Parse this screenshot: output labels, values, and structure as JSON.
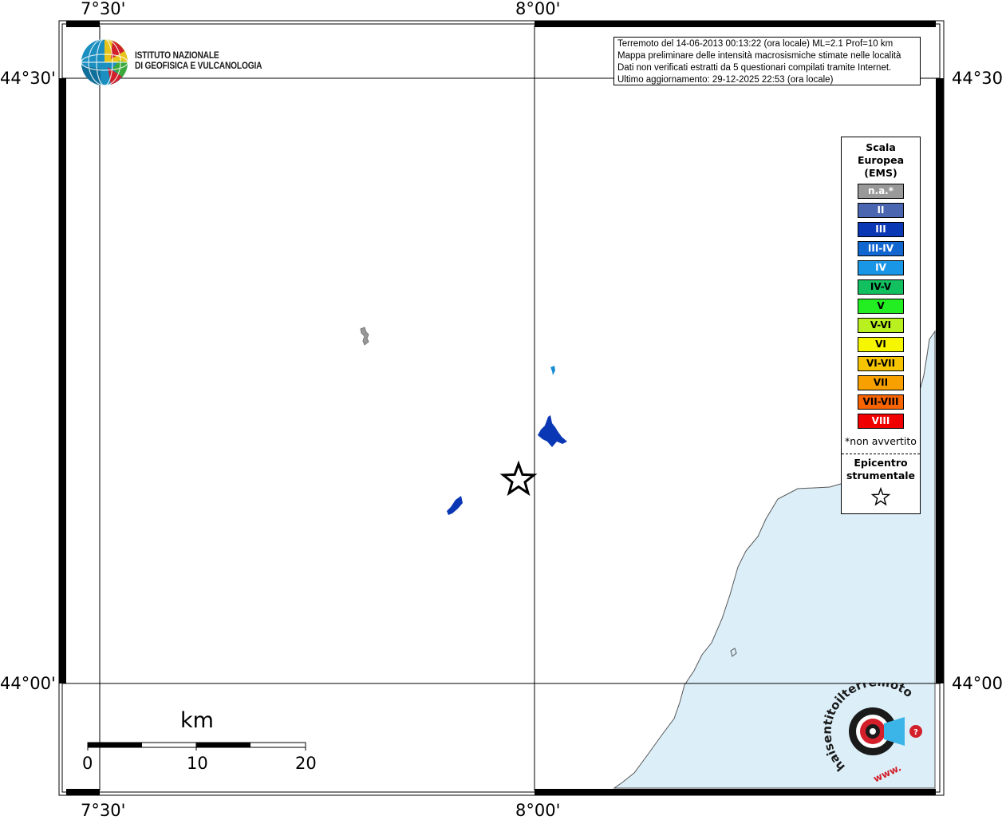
{
  "map": {
    "lon_labels": [
      "7°30'",
      "8°00'"
    ],
    "lat_labels": [
      "44°30'",
      "44°00'"
    ],
    "colors": {
      "sea": "#dceff9",
      "frame": "#000000",
      "grid": "#000000"
    },
    "localities": [
      {
        "intensity": "n.a.",
        "color": "#999999"
      },
      {
        "intensity": "IV",
        "color": "#1a8cd6"
      },
      {
        "intensity": "III",
        "color": "#0a37b4"
      },
      {
        "intensity": "III",
        "color": "#0a37b4"
      }
    ]
  },
  "info": {
    "line1": "Terremoto del 14-06-2013 00:13:22 (ora locale) ML=2.1 Prof=10 km",
    "line2": "Mappa preliminare delle intensità macrosismiche stimate nelle località",
    "line3": "Dati non verificati estratti da 5 questionari compilati tramite Internet.",
    "line4": "Ultimo aggiornamento: 29-12-2025 22:53 (ora locale)"
  },
  "logo": {
    "line1": "ISTITUTO NAZIONALE",
    "line2": "DI GEOFISICA E VULCANOLOGIA",
    "icon": "ingv-globe-logo"
  },
  "legend": {
    "title_lines": [
      "Scala",
      "Europea",
      "(EMS)"
    ],
    "items": [
      {
        "label": "n.a.*",
        "color": "#999999",
        "text_color": "#ffffff"
      },
      {
        "label": "II",
        "color": "#4a66b0",
        "text_color": "#ffffff"
      },
      {
        "label": "III",
        "color": "#0a37b4",
        "text_color": "#ffffff"
      },
      {
        "label": "III-IV",
        "color": "#1166d0",
        "text_color": "#ffffff"
      },
      {
        "label": "IV",
        "color": "#1a96e6",
        "text_color": "#ffffff"
      },
      {
        "label": "IV-V",
        "color": "#12c060",
        "text_color": "#000000"
      },
      {
        "label": "V",
        "color": "#22ee22",
        "text_color": "#000000"
      },
      {
        "label": "V-VI",
        "color": "#b8f020",
        "text_color": "#000000"
      },
      {
        "label": "VI",
        "color": "#f6f600",
        "text_color": "#000000"
      },
      {
        "label": "VI-VII",
        "color": "#f6c400",
        "text_color": "#000000"
      },
      {
        "label": "VII",
        "color": "#f8a000",
        "text_color": "#000000"
      },
      {
        "label": "VII-VIII",
        "color": "#f86400",
        "text_color": "#000000"
      },
      {
        "label": "VIII",
        "color": "#f00000",
        "text_color": "#ffffff"
      }
    ],
    "note": "*non avvertito",
    "epicenter_lines": [
      "Epicentro",
      "strumentale"
    ],
    "epicenter_icon": "star-icon"
  },
  "scale": {
    "unit": "km",
    "ticks": [
      "0",
      "10",
      "20"
    ]
  },
  "badge": {
    "text": "haisentitoilterremoto.it",
    "url_text": "www.",
    "icon": "hst-logo"
  }
}
